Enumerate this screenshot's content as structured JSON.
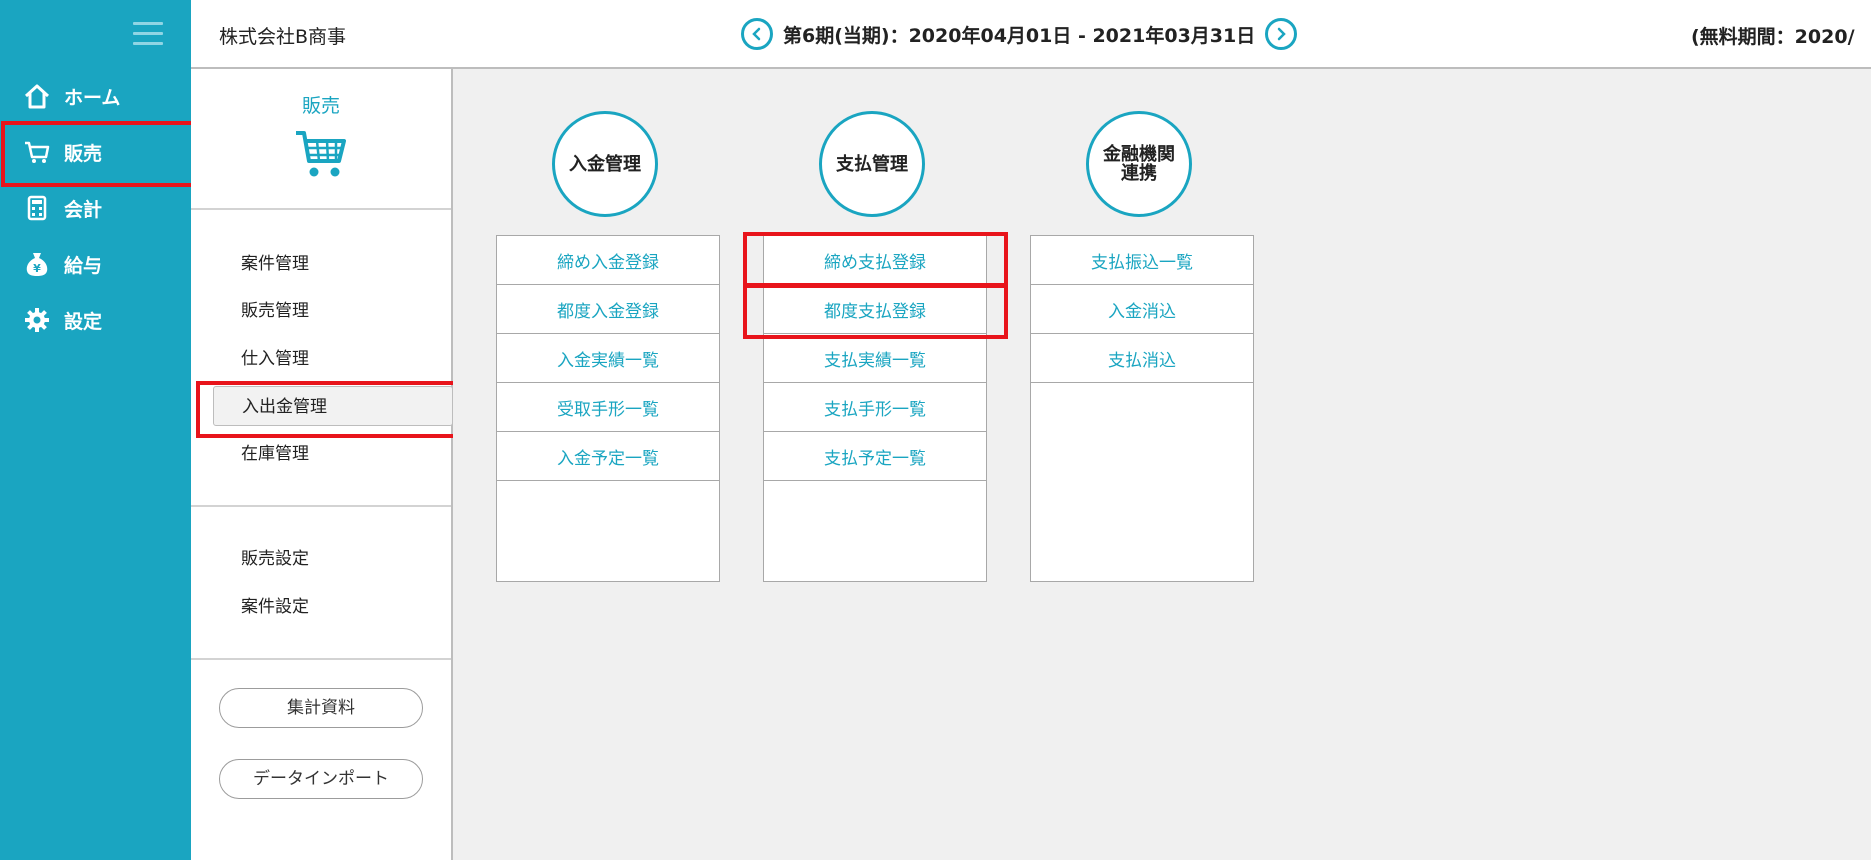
{
  "nav": {
    "items": [
      {
        "label": "ホーム",
        "icon": "home-icon"
      },
      {
        "label": "販売",
        "icon": "cart-icon"
      },
      {
        "label": "会計",
        "icon": "calculator-icon"
      },
      {
        "label": "給与",
        "icon": "money-bag-icon"
      },
      {
        "label": "設定",
        "icon": "gear-icon"
      }
    ]
  },
  "header": {
    "company": "株式会社B商事",
    "period": "第6期(当期)：2020年04月01日 - 2021年03月31日",
    "free_period": "(無料期間：2020/"
  },
  "submenu": {
    "title": "販売",
    "group1": [
      "案件管理",
      "販売管理",
      "仕入管理",
      "入出金管理",
      "在庫管理"
    ],
    "group2": [
      "販売設定",
      "案件設定"
    ],
    "buttons": [
      "集計資料",
      "データインポート"
    ]
  },
  "columns": [
    {
      "title": "入金管理",
      "items": [
        "締め入金登録",
        "都度入金登録",
        "入金実績一覧",
        "受取手形一覧",
        "入金予定一覧"
      ]
    },
    {
      "title": "支払管理",
      "items": [
        "締め支払登録",
        "都度支払登録",
        "支払実績一覧",
        "支払手形一覧",
        "支払予定一覧"
      ]
    },
    {
      "title": "金融機関\n連携",
      "items": [
        "支払振込一覧",
        "入金消込",
        "支払消込"
      ]
    }
  ],
  "colors": {
    "accent": "#1aa5c1",
    "highlight": "#e8141b"
  }
}
